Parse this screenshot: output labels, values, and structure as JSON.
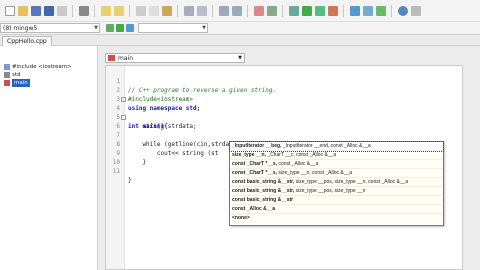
{
  "toolbar": {
    "compiler_select": "(8) mingw5",
    "build_target_select": ""
  },
  "file_tab": {
    "label": "CppHello.cpp"
  },
  "tree": {
    "items": [
      {
        "label": "#include <iostream>",
        "icon": "include-icon"
      },
      {
        "label": "std",
        "icon": "namespace-icon"
      },
      {
        "label": "main",
        "icon": "function-icon",
        "selected": true
      }
    ]
  },
  "scope": {
    "value": "main"
  },
  "code": {
    "lines": [
      {
        "n": "1",
        "text": "// C++ program to reverse a given string."
      },
      {
        "n": "2",
        "text": "#include<iostream>"
      },
      {
        "n": "3",
        "text": "using namespace std;"
      },
      {
        "n": "4",
        "text": "int main(){"
      },
      {
        "n": "5",
        "text": "    string strdata;"
      },
      {
        "n": "6",
        "text": "    while (getline(cin,strdata)){"
      },
      {
        "n": "7",
        "text": ""
      },
      {
        "n": "8",
        "text": "        cout<< string (st"
      },
      {
        "n": "9",
        "text": "    }"
      },
      {
        "n": "10",
        "text": ""
      },
      {
        "n": "11",
        "text": "}"
      }
    ]
  },
  "completion": {
    "items": [
      {
        "bold": "_InputIterator __beg,",
        "rest": " _InputIterator __end, const _Alloc &__a"
      },
      {
        "bold": "size_type __n,",
        "rest": " _CharT __c, const _Alloc &__a"
      },
      {
        "bold": "const _CharT *__s,",
        "rest": " const _Alloc &__a"
      },
      {
        "bold": "const _CharT *__s,",
        "rest": " size_type __n, const _Alloc &__a"
      },
      {
        "bold": "const basic_string &__str,",
        "rest": " size_type __pos, size_type __n, const _Alloc &__a"
      },
      {
        "bold": "const basic_string &__str,",
        "rest": " size_type __pos, size_type __n"
      },
      {
        "bold": "const basic_string &__str",
        "rest": ""
      },
      {
        "bold": "const _Alloc &__a",
        "rest": ""
      },
      {
        "bold": "<none>",
        "rest": ""
      }
    ]
  },
  "colors": {
    "selection": "#2c5fc0",
    "keyword": "#1a1aa6",
    "comment": "#2e7d32"
  }
}
